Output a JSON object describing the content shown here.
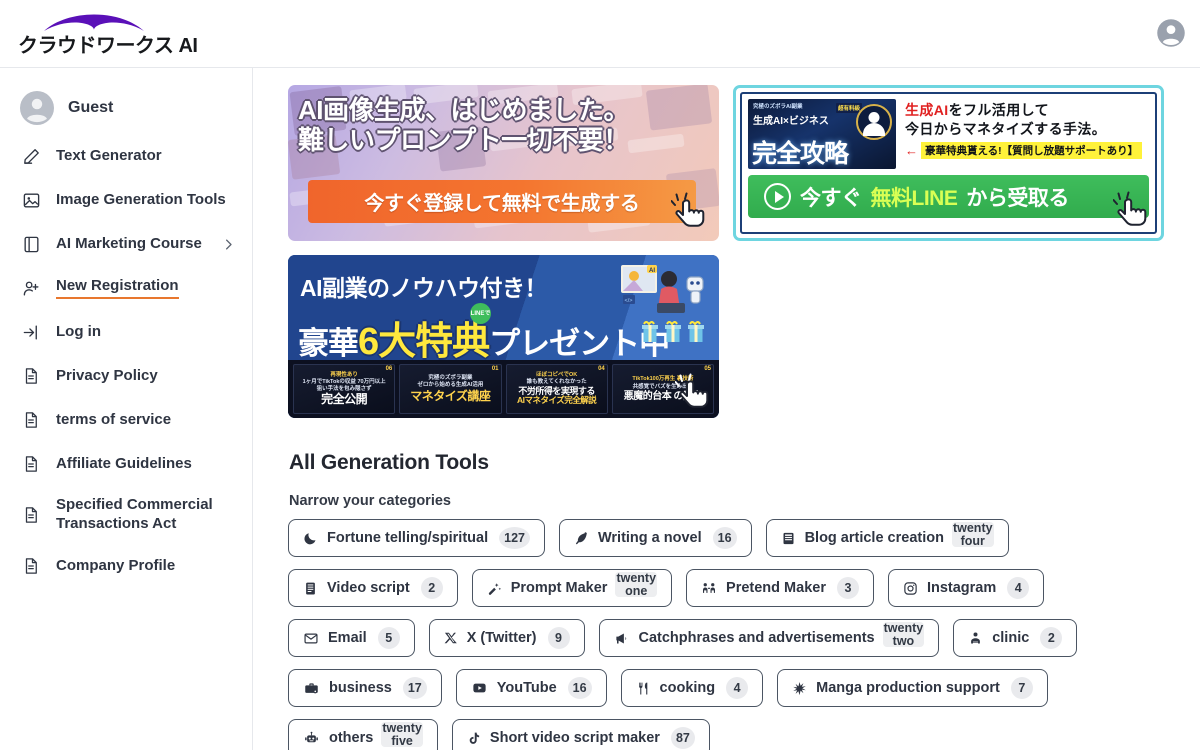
{
  "header": {
    "logo_text": "クラウドワークス AI",
    "avatar_icon": "user-avatar-icon"
  },
  "sidebar": {
    "items": [
      {
        "label": "Guest",
        "icon": "user-avatar-icon",
        "active": false
      },
      {
        "label": "Text Generator",
        "icon": "pencil-icon",
        "active": false
      },
      {
        "label": "Image Generation Tools",
        "icon": "image-icon",
        "active": false
      },
      {
        "label": "AI Marketing Course",
        "icon": "book-icon",
        "active": false,
        "chevron": "chevron-right-icon"
      },
      {
        "label": "New Registration",
        "icon": "user-plus-icon",
        "active": true
      },
      {
        "label": "Log in",
        "icon": "login-arrow-icon",
        "active": false
      },
      {
        "label": "Privacy Policy",
        "icon": "document-icon",
        "active": false
      },
      {
        "label": "terms of service",
        "icon": "document-icon",
        "active": false
      },
      {
        "label": "Affiliate Guidelines",
        "icon": "document-icon",
        "active": false
      },
      {
        "label": "Specified Commercial Transactions Act",
        "icon": "document-icon",
        "active": false
      },
      {
        "label": "Company Profile",
        "icon": "document-icon",
        "active": false
      }
    ]
  },
  "banners": {
    "banner_image_gen": {
      "line1": "AI画像生成、はじめました。",
      "line2": "難しいプロンプト一切不要！",
      "cta": "今すぐ登録して無料で生成する",
      "accent_color": "#f0652c"
    },
    "banner_line": {
      "thumb_small": "究極のズボラAI副業",
      "thumb_badge": "超有料級",
      "thumb_mid": "生成AI×ビジネス",
      "thumb_big": "完全攻略",
      "headline_red": "生成AI",
      "headline_rest": "をフル活用して",
      "headline_line2": "今日からマネタイズする手法。",
      "yellow_strip": "豪華特典貰える!【質問し放題サポートあり】",
      "cta_pre": "今すぐ",
      "cta_lime": "無料LINE",
      "cta_post": "から受取る",
      "border_color": "#6ed5e0",
      "cta_color": "#31ac4d"
    },
    "banner_benefits": {
      "line1": "AI副業のノウハウ付き！",
      "line2_pre": "豪華",
      "line2_yellow": "6大特典",
      "line2_post": "プレゼント中",
      "line_badge": "LINEで",
      "cards": [
        {
          "top": "再現性あり",
          "mid": "1ヶ月でTikTokの収益 70万円以上",
          "sub": "狙い手法を包み隠さず",
          "big": "完全公開",
          "big_color": "white",
          "num": "06"
        },
        {
          "top": "",
          "mid": "究極のズボラ副業",
          "sub": "ゼロから始める生成AI活用",
          "big": "マネタイズ講座",
          "big_color": "gold",
          "num": "01"
        },
        {
          "top": "ほぼコピペでOK",
          "mid": "誰も教えてくれなかった",
          "sub": "不労所得を実現する",
          "big": "AIマネタイズ完全解説",
          "big_color": "gold",
          "num": "04"
        },
        {
          "top": "TikTok100万再生 裏技術",
          "mid": "共感覚でバズを生み出す",
          "sub": "",
          "big": "悪魔的台本 の魔力",
          "big_color": "white",
          "num": "05"
        }
      ]
    }
  },
  "main": {
    "section_title": "All Generation Tools",
    "section_subtitle": "Narrow your categories",
    "categories": [
      {
        "label": "Fortune telling/spiritual",
        "count": "127",
        "icon": "moon-icon"
      },
      {
        "label": "Writing a novel",
        "count": "16",
        "icon": "feather-pen-icon"
      },
      {
        "label": "Blog article creation",
        "count": "twenty four",
        "icon": "book-icon"
      },
      {
        "label": "Video script",
        "count": "2",
        "icon": "script-icon"
      },
      {
        "label": "Prompt Maker",
        "count": "twenty one",
        "icon": "wand-icon"
      },
      {
        "label": "Pretend Maker",
        "count": "3",
        "icon": "people-icon"
      },
      {
        "label": "Instagram",
        "count": "4",
        "icon": "instagram-icon"
      },
      {
        "label": "Email",
        "count": "5",
        "icon": "envelope-icon"
      },
      {
        "label": "X (Twitter)",
        "count": "9",
        "icon": "x-twitter-icon"
      },
      {
        "label": "Catchphrases and advertisements",
        "count": "twenty two",
        "icon": "megaphone-icon"
      },
      {
        "label": "clinic",
        "count": "2",
        "icon": "clinic-icon"
      },
      {
        "label": "business",
        "count": "17",
        "icon": "briefcase-icon"
      },
      {
        "label": "YouTube",
        "count": "16",
        "icon": "youtube-icon"
      },
      {
        "label": "cooking",
        "count": "4",
        "icon": "fork-knife-icon"
      },
      {
        "label": "Manga production support",
        "count": "7",
        "icon": "sparkle-icon"
      },
      {
        "label": "others",
        "count": "twenty five",
        "icon": "robot-icon"
      },
      {
        "label": "Short video script maker",
        "count": "87",
        "icon": "tiktok-icon"
      }
    ]
  }
}
